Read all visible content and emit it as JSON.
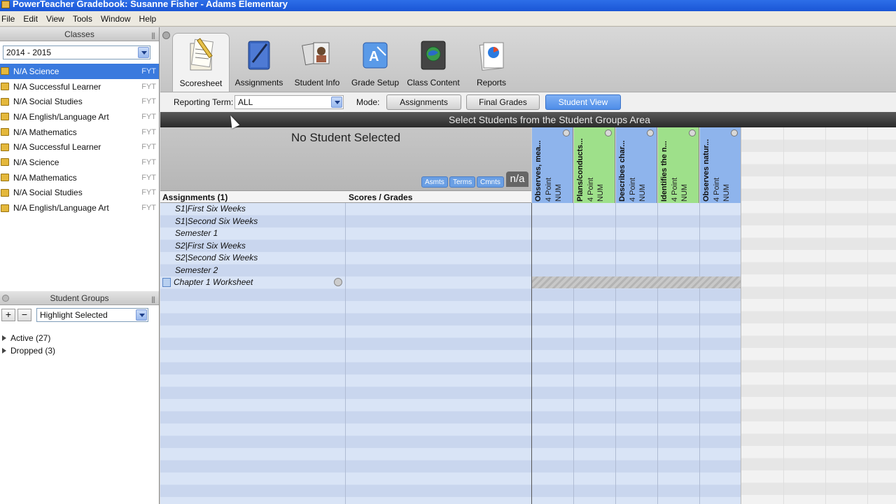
{
  "window": {
    "title": "PowerTeacher Gradebook: Susanne Fisher - Adams Elementary"
  },
  "menu": [
    "File",
    "Edit",
    "View",
    "Tools",
    "Window",
    "Help"
  ],
  "classes_panel": {
    "title": "Classes",
    "year": "2014 - 2015",
    "items": [
      {
        "name": "N/A Science",
        "code": "FYT",
        "selected": true
      },
      {
        "name": "N/A Successful Learner",
        "code": "FYT"
      },
      {
        "name": "N/A Social Studies",
        "code": "FYT"
      },
      {
        "name": "N/A English/Language Art",
        "code": "FYT"
      },
      {
        "name": "N/A Mathematics",
        "code": "FYT"
      },
      {
        "name": "N/A Successful Learner",
        "code": "FYT"
      },
      {
        "name": "N/A Science",
        "code": "FYT"
      },
      {
        "name": "N/A Mathematics",
        "code": "FYT"
      },
      {
        "name": "N/A Social Studies",
        "code": "FYT"
      },
      {
        "name": "N/A English/Language Art",
        "code": "FYT"
      }
    ]
  },
  "groups_panel": {
    "title": "Student Groups",
    "add": "+",
    "remove": "−",
    "highlight_select": "Highlight Selected",
    "groups": [
      "Active (27)",
      "Dropped (3)"
    ]
  },
  "tabs": [
    {
      "label": "Scoresheet",
      "icon": "scoresheet-icon",
      "active": true
    },
    {
      "label": "Assignments",
      "icon": "assignments-icon"
    },
    {
      "label": "Student Info",
      "icon": "student-info-icon"
    },
    {
      "label": "Grade Setup",
      "icon": "grade-setup-icon"
    },
    {
      "label": "Class Content",
      "icon": "class-content-icon"
    },
    {
      "label": "Reports",
      "icon": "reports-icon"
    }
  ],
  "controls": {
    "reporting_term_label": "Reporting Term:",
    "reporting_term_value": "ALL",
    "mode_label": "Mode:",
    "modes": [
      "Assignments",
      "Final Grades",
      "Student View"
    ],
    "active_mode": "Student View"
  },
  "banner": "Select Students from the Student Groups Area",
  "student": {
    "status": "No Student Selected",
    "pills": [
      "Asmts",
      "Terms",
      "Cmnts"
    ],
    "badge": "n/a"
  },
  "grid": {
    "col_assignments": "Assignments (1)",
    "col_scores": "Scores / Grades",
    "rows": [
      {
        "label": "S1|First Six Weeks"
      },
      {
        "label": "S1|Second Six Weeks"
      },
      {
        "label": "Semester 1"
      },
      {
        "label": "S2|First Six Weeks"
      },
      {
        "label": "S2|Second Six Weeks"
      },
      {
        "label": "Semester 2"
      },
      {
        "label": "Chapter 1 Worksheet",
        "has_icon": true
      }
    ]
  },
  "standards_columns": [
    {
      "title": "Observes, mea...",
      "points": "4 Point",
      "type": "NUM",
      "color": "#8eb4ec"
    },
    {
      "title": "Plans/conducts...",
      "points": "4 Point",
      "type": "NUM",
      "color": "#9ee08a"
    },
    {
      "title": "Describes char...",
      "points": "4 Point",
      "type": "NUM",
      "color": "#8eb4ec"
    },
    {
      "title": "Identifies the n...",
      "points": "4 Point",
      "type": "NUM",
      "color": "#9ee08a"
    },
    {
      "title": "Observes natur...",
      "points": "4 Point",
      "type": "NUM",
      "color": "#8eb4ec"
    }
  ]
}
